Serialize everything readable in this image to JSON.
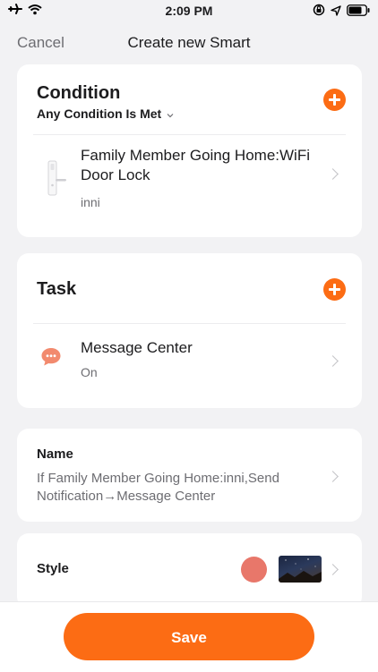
{
  "status_bar": {
    "time": "2:09 PM"
  },
  "nav": {
    "cancel_label": "Cancel",
    "title": "Create new Smart"
  },
  "condition_card": {
    "title": "Condition",
    "match_mode": "Any Condition Is Met",
    "item": {
      "title": "Family Member Going Home:WiFi Door Lock",
      "subtitle": "inni",
      "icon": "door-lock-icon"
    }
  },
  "task_card": {
    "title": "Task",
    "item": {
      "title": "Message Center",
      "subtitle": "On",
      "icon": "message-center-icon",
      "icon_color": "#f28a6e"
    }
  },
  "name_card": {
    "label": "Name",
    "value": "If Family Member Going Home:inni,Send Notification→Message Center"
  },
  "style_card": {
    "label": "Style",
    "color": "#e8776a",
    "background_image": "night-sky-thumbnail"
  },
  "save_label": "Save",
  "colors": {
    "accent": "#fc6c14",
    "background": "#f2f2f4"
  }
}
